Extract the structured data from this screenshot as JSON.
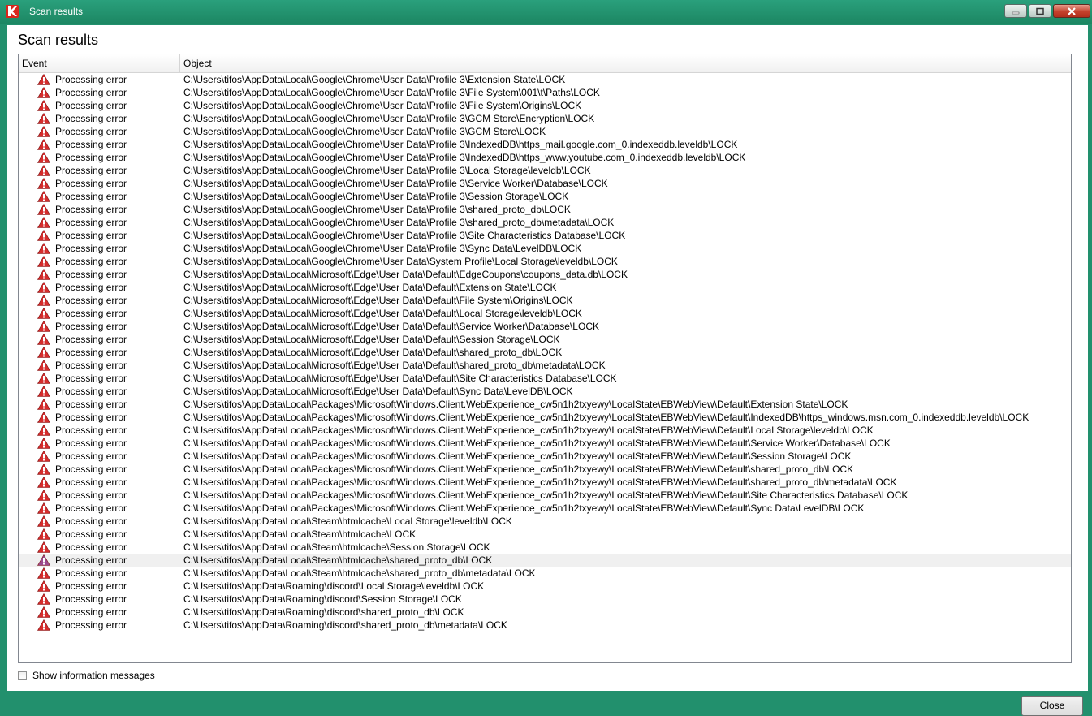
{
  "window": {
    "title": "Scan results",
    "accent_color": "#22906d"
  },
  "heading": "Scan results",
  "table": {
    "columns": [
      "Event",
      "Object"
    ],
    "selected_index": 37,
    "rows": [
      {
        "event": "Processing error",
        "icon": "warning-icon",
        "object": "C:\\Users\\tifos\\AppData\\Local\\Google\\Chrome\\User Data\\Profile 3\\Extension State\\LOCK"
      },
      {
        "event": "Processing error",
        "icon": "warning-icon",
        "object": "C:\\Users\\tifos\\AppData\\Local\\Google\\Chrome\\User Data\\Profile 3\\File System\\001\\t\\Paths\\LOCK"
      },
      {
        "event": "Processing error",
        "icon": "warning-icon",
        "object": "C:\\Users\\tifos\\AppData\\Local\\Google\\Chrome\\User Data\\Profile 3\\File System\\Origins\\LOCK"
      },
      {
        "event": "Processing error",
        "icon": "warning-icon",
        "object": "C:\\Users\\tifos\\AppData\\Local\\Google\\Chrome\\User Data\\Profile 3\\GCM Store\\Encryption\\LOCK"
      },
      {
        "event": "Processing error",
        "icon": "warning-icon",
        "object": "C:\\Users\\tifos\\AppData\\Local\\Google\\Chrome\\User Data\\Profile 3\\GCM Store\\LOCK"
      },
      {
        "event": "Processing error",
        "icon": "warning-icon",
        "object": "C:\\Users\\tifos\\AppData\\Local\\Google\\Chrome\\User Data\\Profile 3\\IndexedDB\\https_mail.google.com_0.indexeddb.leveldb\\LOCK"
      },
      {
        "event": "Processing error",
        "icon": "warning-icon",
        "object": "C:\\Users\\tifos\\AppData\\Local\\Google\\Chrome\\User Data\\Profile 3\\IndexedDB\\https_www.youtube.com_0.indexeddb.leveldb\\LOCK"
      },
      {
        "event": "Processing error",
        "icon": "warning-icon",
        "object": "C:\\Users\\tifos\\AppData\\Local\\Google\\Chrome\\User Data\\Profile 3\\Local Storage\\leveldb\\LOCK"
      },
      {
        "event": "Processing error",
        "icon": "warning-icon",
        "object": "C:\\Users\\tifos\\AppData\\Local\\Google\\Chrome\\User Data\\Profile 3\\Service Worker\\Database\\LOCK"
      },
      {
        "event": "Processing error",
        "icon": "warning-icon",
        "object": "C:\\Users\\tifos\\AppData\\Local\\Google\\Chrome\\User Data\\Profile 3\\Session Storage\\LOCK"
      },
      {
        "event": "Processing error",
        "icon": "warning-icon",
        "object": "C:\\Users\\tifos\\AppData\\Local\\Google\\Chrome\\User Data\\Profile 3\\shared_proto_db\\LOCK"
      },
      {
        "event": "Processing error",
        "icon": "warning-icon",
        "object": "C:\\Users\\tifos\\AppData\\Local\\Google\\Chrome\\User Data\\Profile 3\\shared_proto_db\\metadata\\LOCK"
      },
      {
        "event": "Processing error",
        "icon": "warning-icon",
        "object": "C:\\Users\\tifos\\AppData\\Local\\Google\\Chrome\\User Data\\Profile 3\\Site Characteristics Database\\LOCK"
      },
      {
        "event": "Processing error",
        "icon": "warning-icon",
        "object": "C:\\Users\\tifos\\AppData\\Local\\Google\\Chrome\\User Data\\Profile 3\\Sync Data\\LevelDB\\LOCK"
      },
      {
        "event": "Processing error",
        "icon": "warning-icon",
        "object": "C:\\Users\\tifos\\AppData\\Local\\Google\\Chrome\\User Data\\System Profile\\Local Storage\\leveldb\\LOCK"
      },
      {
        "event": "Processing error",
        "icon": "warning-icon",
        "object": "C:\\Users\\tifos\\AppData\\Local\\Microsoft\\Edge\\User Data\\Default\\EdgeCoupons\\coupons_data.db\\LOCK"
      },
      {
        "event": "Processing error",
        "icon": "warning-icon",
        "object": "C:\\Users\\tifos\\AppData\\Local\\Microsoft\\Edge\\User Data\\Default\\Extension State\\LOCK"
      },
      {
        "event": "Processing error",
        "icon": "warning-icon",
        "object": "C:\\Users\\tifos\\AppData\\Local\\Microsoft\\Edge\\User Data\\Default\\File System\\Origins\\LOCK"
      },
      {
        "event": "Processing error",
        "icon": "warning-icon",
        "object": "C:\\Users\\tifos\\AppData\\Local\\Microsoft\\Edge\\User Data\\Default\\Local Storage\\leveldb\\LOCK"
      },
      {
        "event": "Processing error",
        "icon": "warning-icon",
        "object": "C:\\Users\\tifos\\AppData\\Local\\Microsoft\\Edge\\User Data\\Default\\Service Worker\\Database\\LOCK"
      },
      {
        "event": "Processing error",
        "icon": "warning-icon",
        "object": "C:\\Users\\tifos\\AppData\\Local\\Microsoft\\Edge\\User Data\\Default\\Session Storage\\LOCK"
      },
      {
        "event": "Processing error",
        "icon": "warning-icon",
        "object": "C:\\Users\\tifos\\AppData\\Local\\Microsoft\\Edge\\User Data\\Default\\shared_proto_db\\LOCK"
      },
      {
        "event": "Processing error",
        "icon": "warning-icon",
        "object": "C:\\Users\\tifos\\AppData\\Local\\Microsoft\\Edge\\User Data\\Default\\shared_proto_db\\metadata\\LOCK"
      },
      {
        "event": "Processing error",
        "icon": "warning-icon",
        "object": "C:\\Users\\tifos\\AppData\\Local\\Microsoft\\Edge\\User Data\\Default\\Site Characteristics Database\\LOCK"
      },
      {
        "event": "Processing error",
        "icon": "warning-icon",
        "object": "C:\\Users\\tifos\\AppData\\Local\\Microsoft\\Edge\\User Data\\Default\\Sync Data\\LevelDB\\LOCK"
      },
      {
        "event": "Processing error",
        "icon": "warning-icon",
        "object": "C:\\Users\\tifos\\AppData\\Local\\Packages\\MicrosoftWindows.Client.WebExperience_cw5n1h2txyewy\\LocalState\\EBWebView\\Default\\Extension State\\LOCK"
      },
      {
        "event": "Processing error",
        "icon": "warning-icon",
        "object": "C:\\Users\\tifos\\AppData\\Local\\Packages\\MicrosoftWindows.Client.WebExperience_cw5n1h2txyewy\\LocalState\\EBWebView\\Default\\IndexedDB\\https_windows.msn.com_0.indexeddb.leveldb\\LOCK"
      },
      {
        "event": "Processing error",
        "icon": "warning-icon",
        "object": "C:\\Users\\tifos\\AppData\\Local\\Packages\\MicrosoftWindows.Client.WebExperience_cw5n1h2txyewy\\LocalState\\EBWebView\\Default\\Local Storage\\leveldb\\LOCK"
      },
      {
        "event": "Processing error",
        "icon": "warning-icon",
        "object": "C:\\Users\\tifos\\AppData\\Local\\Packages\\MicrosoftWindows.Client.WebExperience_cw5n1h2txyewy\\LocalState\\EBWebView\\Default\\Service Worker\\Database\\LOCK"
      },
      {
        "event": "Processing error",
        "icon": "warning-icon",
        "object": "C:\\Users\\tifos\\AppData\\Local\\Packages\\MicrosoftWindows.Client.WebExperience_cw5n1h2txyewy\\LocalState\\EBWebView\\Default\\Session Storage\\LOCK"
      },
      {
        "event": "Processing error",
        "icon": "warning-icon",
        "object": "C:\\Users\\tifos\\AppData\\Local\\Packages\\MicrosoftWindows.Client.WebExperience_cw5n1h2txyewy\\LocalState\\EBWebView\\Default\\shared_proto_db\\LOCK"
      },
      {
        "event": "Processing error",
        "icon": "warning-icon",
        "object": "C:\\Users\\tifos\\AppData\\Local\\Packages\\MicrosoftWindows.Client.WebExperience_cw5n1h2txyewy\\LocalState\\EBWebView\\Default\\shared_proto_db\\metadata\\LOCK"
      },
      {
        "event": "Processing error",
        "icon": "warning-icon",
        "object": "C:\\Users\\tifos\\AppData\\Local\\Packages\\MicrosoftWindows.Client.WebExperience_cw5n1h2txyewy\\LocalState\\EBWebView\\Default\\Site Characteristics Database\\LOCK"
      },
      {
        "event": "Processing error",
        "icon": "warning-icon",
        "object": "C:\\Users\\tifos\\AppData\\Local\\Packages\\MicrosoftWindows.Client.WebExperience_cw5n1h2txyewy\\LocalState\\EBWebView\\Default\\Sync Data\\LevelDB\\LOCK"
      },
      {
        "event": "Processing error",
        "icon": "warning-icon",
        "object": "C:\\Users\\tifos\\AppData\\Local\\Steam\\htmlcache\\Local Storage\\leveldb\\LOCK"
      },
      {
        "event": "Processing error",
        "icon": "warning-icon",
        "object": "C:\\Users\\tifos\\AppData\\Local\\Steam\\htmlcache\\LOCK"
      },
      {
        "event": "Processing error",
        "icon": "warning-icon",
        "object": "C:\\Users\\tifos\\AppData\\Local\\Steam\\htmlcache\\Session Storage\\LOCK"
      },
      {
        "event": "Processing error",
        "icon": "warning-icon",
        "object": "C:\\Users\\tifos\\AppData\\Local\\Steam\\htmlcache\\shared_proto_db\\LOCK"
      },
      {
        "event": "Processing error",
        "icon": "warning-icon",
        "object": "C:\\Users\\tifos\\AppData\\Local\\Steam\\htmlcache\\shared_proto_db\\metadata\\LOCK"
      },
      {
        "event": "Processing error",
        "icon": "warning-icon",
        "object": "C:\\Users\\tifos\\AppData\\Roaming\\discord\\Local Storage\\leveldb\\LOCK"
      },
      {
        "event": "Processing error",
        "icon": "warning-icon",
        "object": "C:\\Users\\tifos\\AppData\\Roaming\\discord\\Session Storage\\LOCK"
      },
      {
        "event": "Processing error",
        "icon": "warning-icon",
        "object": "C:\\Users\\tifos\\AppData\\Roaming\\discord\\shared_proto_db\\LOCK"
      },
      {
        "event": "Processing error",
        "icon": "warning-icon",
        "object": "C:\\Users\\tifos\\AppData\\Roaming\\discord\\shared_proto_db\\metadata\\LOCK"
      }
    ],
    "warning_color": "#d62c2c",
    "selected_warning_color": "#9b4a8f"
  },
  "checkbox": {
    "label": "Show information messages",
    "checked": false
  },
  "close_button": {
    "label": "Close"
  }
}
